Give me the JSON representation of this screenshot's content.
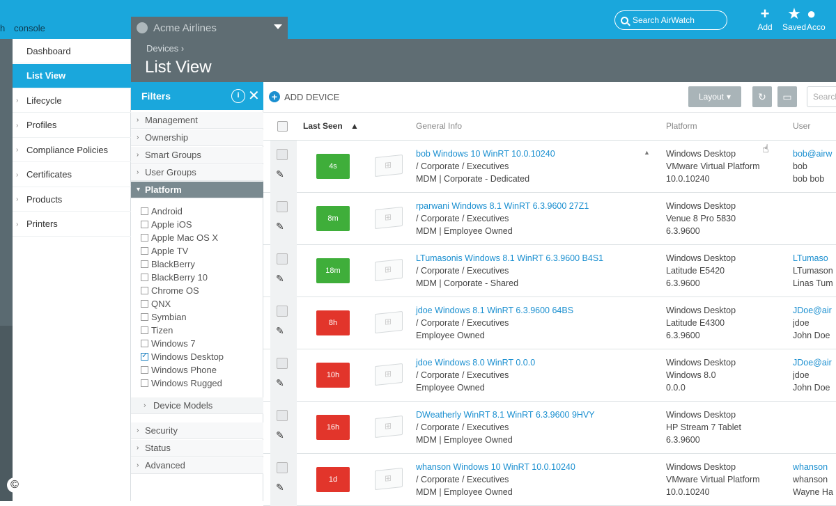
{
  "app": {
    "brand_prefix": "h",
    "brand_suffix": "console",
    "org": "Acme Airlines"
  },
  "topbar": {
    "search_placeholder": "Search AirWatch",
    "actions": [
      {
        "icon": "plus-icon",
        "glyph": "+",
        "label": "Add"
      },
      {
        "icon": "star-icon",
        "glyph": "★",
        "label": "Saved"
      },
      {
        "icon": "account-icon",
        "glyph": "●",
        "label": "Acco"
      }
    ]
  },
  "leftnav": [
    {
      "label": "Dashboard",
      "active": false,
      "chevron": false
    },
    {
      "label": "List View",
      "active": true,
      "chevron": false
    },
    {
      "label": "Lifecycle",
      "active": false,
      "chevron": true
    },
    {
      "label": "Profiles",
      "active": false,
      "chevron": true
    },
    {
      "label": "Compliance Policies",
      "active": false,
      "chevron": true
    },
    {
      "label": "Certificates",
      "active": false,
      "chevron": true
    },
    {
      "label": "Products",
      "active": false,
      "chevron": true
    },
    {
      "label": "Printers",
      "active": false,
      "chevron": true
    }
  ],
  "header": {
    "breadcrumb": "Devices",
    "title": "List View"
  },
  "filters": {
    "title": "Filters",
    "sections_top": [
      "Management",
      "Ownership",
      "Smart Groups",
      "User Groups"
    ],
    "open_section": "Platform",
    "platforms": [
      {
        "label": "Android",
        "checked": false
      },
      {
        "label": "Apple iOS",
        "checked": false
      },
      {
        "label": "Apple Mac OS X",
        "checked": false
      },
      {
        "label": "Apple TV",
        "checked": false
      },
      {
        "label": "BlackBerry",
        "checked": false
      },
      {
        "label": "BlackBerry 10",
        "checked": false
      },
      {
        "label": "Chrome OS",
        "checked": false
      },
      {
        "label": "QNX",
        "checked": false
      },
      {
        "label": "Symbian",
        "checked": false
      },
      {
        "label": "Tizen",
        "checked": false
      },
      {
        "label": "Windows 7",
        "checked": false
      },
      {
        "label": "Windows Desktop",
        "checked": true
      },
      {
        "label": "Windows Phone",
        "checked": false
      },
      {
        "label": "Windows Rugged",
        "checked": false
      }
    ],
    "subsection": "Device Models",
    "sections_bottom": [
      "Security",
      "Status",
      "Advanced"
    ]
  },
  "toolbar": {
    "add_device": "ADD DEVICE",
    "layout": "Layout",
    "search_placeholder": "Search"
  },
  "table": {
    "columns": {
      "last_seen": "Last Seen",
      "general_info": "General Info",
      "platform": "Platform",
      "user": "User"
    },
    "rows": [
      {
        "last_seen": "4s",
        "status": "green",
        "name": "bob Windows 10 WinRT 10.0.10240",
        "group": "/ Corporate / Executives",
        "ownership": "MDM | Corporate - Dedicated",
        "platform": "Windows Desktop",
        "model": "VMware Virtual Platform",
        "os": "10.0.10240",
        "user_email": "bob@airw",
        "username": "bob",
        "fullname": "bob bob",
        "locked": true
      },
      {
        "last_seen": "8m",
        "status": "green",
        "name": "rparwani Windows 8.1 WinRT 6.3.9600 27Z1",
        "group": "/ Corporate / Executives",
        "ownership": "MDM | Employee Owned",
        "platform": "Windows Desktop",
        "model": "Venue 8 Pro 5830",
        "os": "6.3.9600",
        "user_email": "",
        "username": "",
        "fullname": "",
        "locked": false
      },
      {
        "last_seen": "18m",
        "status": "green",
        "name": "LTumasonis Windows 8.1 WinRT 6.3.9600 B4S1",
        "group": "/ Corporate / Executives",
        "ownership": "MDM | Corporate - Shared",
        "platform": "Windows Desktop",
        "model": "Latitude E5420",
        "os": "6.3.9600",
        "user_email": "LTumaso",
        "username": "LTumason",
        "fullname": "Linas Tum",
        "locked": false
      },
      {
        "last_seen": "8h",
        "status": "red",
        "name": "jdoe Windows 8.1 WinRT 6.3.9600 64BS",
        "group": "/ Corporate / Executives",
        "ownership": "Employee Owned",
        "platform": "Windows Desktop",
        "model": "Latitude E4300",
        "os": "6.3.9600",
        "user_email": "JDoe@air",
        "username": "jdoe",
        "fullname": "John Doe",
        "locked": false
      },
      {
        "last_seen": "10h",
        "status": "red",
        "name": "jdoe Windows 8.0 WinRT 0.0.0",
        "group": "/ Corporate / Executives",
        "ownership": "Employee Owned",
        "platform": "Windows Desktop",
        "model": "Windows 8.0",
        "os": "0.0.0",
        "user_email": "JDoe@air",
        "username": "jdoe",
        "fullname": "John Doe",
        "locked": false
      },
      {
        "last_seen": "16h",
        "status": "red",
        "name": "DWeatherly WinRT 8.1 WinRT 6.3.9600 9HVY",
        "group": "/ Corporate / Executives",
        "ownership": "MDM | Employee Owned",
        "platform": "Windows Desktop",
        "model": "HP Stream 7 Tablet",
        "os": "6.3.9600",
        "user_email": "",
        "username": "",
        "fullname": "",
        "locked": false
      },
      {
        "last_seen": "1d",
        "status": "red",
        "name": "whanson Windows 10 WinRT 10.0.10240",
        "group": "/ Corporate / Executives",
        "ownership": "MDM | Employee Owned",
        "platform": "Windows Desktop",
        "model": "VMware Virtual Platform",
        "os": "10.0.10240",
        "user_email": "whanson",
        "username": "whanson",
        "fullname": "Wayne Ha",
        "locked": false
      }
    ]
  },
  "colors": {
    "accent": "#1aa7dc",
    "header": "#5f6d73",
    "link": "#1a8fd0",
    "status_green": "#3fae3a",
    "status_red": "#e2352b"
  },
  "footer": {
    "copyright": "©"
  }
}
